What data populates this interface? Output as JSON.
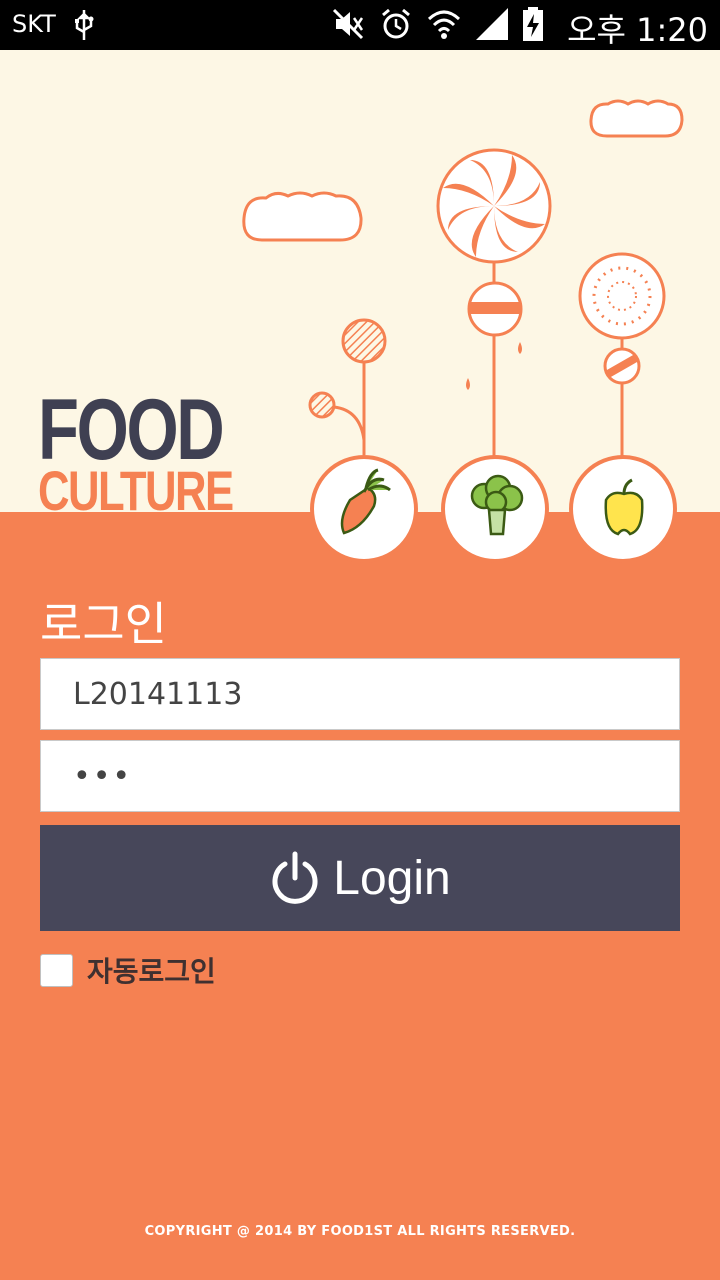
{
  "status_bar": {
    "carrier": "SKT",
    "time": "오후 1:20"
  },
  "logo": {
    "line1": "FOOD",
    "line2": "CULTURE"
  },
  "login": {
    "title": "로그인",
    "user_id_value": "L20141113",
    "password_masked": "•••",
    "button_label": "Login",
    "auto_login_label": "자동로그인",
    "auto_login_checked": false
  },
  "footer": {
    "copyright": "COPYRIGHT @ 2014 BY FOOD1ST ALL RIGHTS RESERVED."
  },
  "colors": {
    "accent": "#f58152",
    "cream": "#fdf7e5",
    "dark": "#47475a"
  }
}
